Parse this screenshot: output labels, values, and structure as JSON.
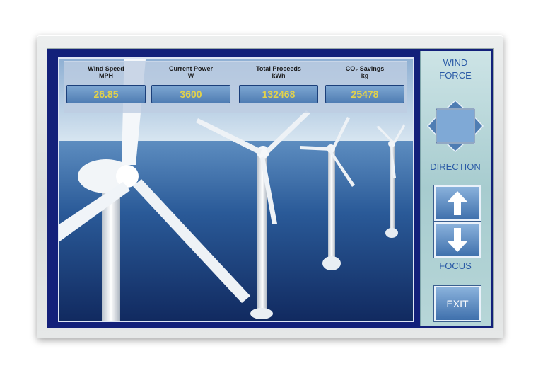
{
  "readouts": [
    {
      "label_line1": "Wind Speed",
      "label_line2": "MPH",
      "value": "26.85"
    },
    {
      "label_line1": "Current Power",
      "label_line2": "W",
      "value": "3600"
    },
    {
      "label_line1": "Total Proceeds",
      "label_line2": "kWh",
      "value": "132468"
    },
    {
      "label_line1": "CO₂ Savings",
      "label_line2": "kg",
      "value": "25478"
    }
  ],
  "sidebar": {
    "title_line1": "WIND",
    "title_line2": "FORCE",
    "direction_label": "DIRECTION",
    "focus_label": "FOCUS",
    "exit_label": "EXIT"
  },
  "colors": {
    "value_text": "#e3d24a",
    "label_text": "#2a5aa6",
    "button_blue": "#4f7db3"
  }
}
